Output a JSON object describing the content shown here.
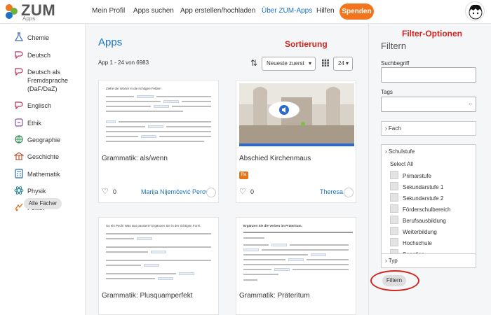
{
  "header": {
    "logo_text": "ZUM",
    "logo_sub": "Apps",
    "nav": [
      "Mein Profil",
      "Apps suchen",
      "App erstellen/hochladen",
      "Über ZUM-Apps",
      "Hilfen"
    ],
    "donate": "Spenden"
  },
  "sidebar": {
    "items": [
      {
        "label": "Chemie",
        "icon": "flask-icon"
      },
      {
        "label": "Deutsch",
        "icon": "speech-icon"
      },
      {
        "label": "Deutsch als Fremdsprache (DaF/DaZ)",
        "icon": "speech-icon"
      },
      {
        "label": "Englisch",
        "icon": "speech-icon"
      },
      {
        "label": "Ethik",
        "icon": "ethics-icon"
      },
      {
        "label": "Geographie",
        "icon": "globe-icon"
      },
      {
        "label": "Geschichte",
        "icon": "history-icon"
      },
      {
        "label": "Mathematik",
        "icon": "calculator-icon"
      },
      {
        "label": "Physik",
        "icon": "atom-icon"
      },
      {
        "label": "Politik",
        "icon": "politics-icon"
      }
    ],
    "all_subjects": "Alle Fächer"
  },
  "main": {
    "title": "Apps",
    "count": "App 1 - 24 von 6983",
    "sort_selected": "Neueste zuerst",
    "per_page": "24",
    "cards": [
      {
        "title": "Grammatik: als/wenn",
        "likes": "0",
        "author": "Marija Nijemčević Perović",
        "badge": "",
        "thumb_heading": "Ziehe die Wörter in die richtigen Felder!"
      },
      {
        "title": "Abschied Kirchenmaus",
        "likes": "0",
        "author": "Theresa",
        "badge": "Re",
        "thumb_heading": ""
      },
      {
        "title": "Grammatik: Plusquamperfekt",
        "likes": "",
        "author": "",
        "badge": "",
        "thumb_heading": "So ein Pech! Was war passiert? Ergänzen Sie in der richtigen Form."
      },
      {
        "title": "Grammatik: Präteritum",
        "likes": "",
        "author": "",
        "badge": "",
        "thumb_heading": "Ergänzen Sie die Verben im Präteritum."
      }
    ]
  },
  "filters": {
    "title": "Filtern",
    "search_label": "Suchbegriff",
    "tags_label": "Tags",
    "fach": "› Fach",
    "schulstufe": "› Schulstufe",
    "select_all": "Select All",
    "levels": [
      "Primarstufe",
      "Sekundarstufe 1",
      "Sekundarstufe 2",
      "Förderschulbereich",
      "Berufsausbildung",
      "Weiterbildung",
      "Hochschule",
      "Sonstige"
    ],
    "typ": "› Typ",
    "submit": "Filtern"
  },
  "annotations": {
    "sort": "Sortierung",
    "filter": "Filter-Optionen"
  },
  "colors": {
    "accent": "#1a73c5",
    "donate": "#f2741c",
    "annotation": "#d1261f"
  }
}
